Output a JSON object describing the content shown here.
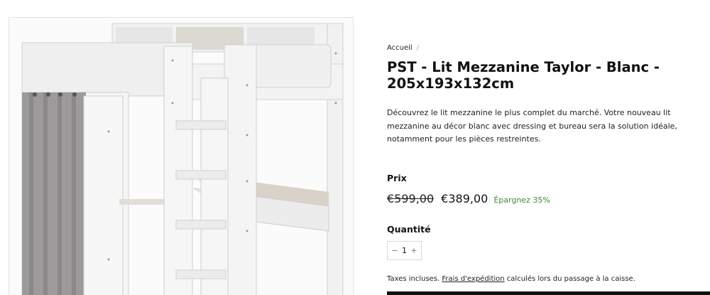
{
  "product_image": {
    "alt": ""
  },
  "breadcrumb": {
    "home_label": "Accueil",
    "separator": "/"
  },
  "product": {
    "title": "PST - Lit Mezzanine Taylor - Blanc - 205x193x132cm",
    "description": "Découvrez le lit mezzanine le plus complet du marché. Votre nouveau lit mezzanine au décor blanc avec dressing et bureau sera la solution idéale, notamment pour les pièces restreintes."
  },
  "price": {
    "label": "Prix",
    "original": "€599,00",
    "sale": "€389,00",
    "savings": "Épargnez 35%"
  },
  "quantity": {
    "label": "Quantité",
    "value": "1",
    "decrease": "−",
    "increase": "+"
  },
  "tax_note": {
    "prefix": "Taxes incluses.",
    "link": "Frais d'expédition",
    "suffix": "calculés lors du passage à la caisse."
  },
  "colors": {
    "savings_green": "#3f8a3a",
    "cta_black": "#111111"
  }
}
